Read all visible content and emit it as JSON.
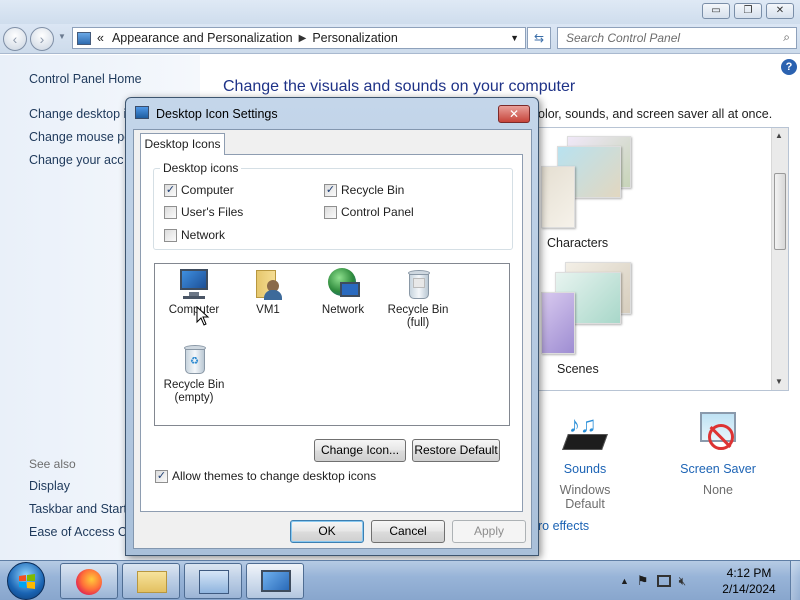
{
  "window": {
    "minimize": "▭",
    "maximize": "❐",
    "close": "✕"
  },
  "address_bar": {
    "prefix": "«",
    "crumbs": [
      "Appearance and Personalization",
      "Personalization"
    ],
    "search_placeholder": "Search Control Panel"
  },
  "left_pane": {
    "links": [
      "Control Panel Home",
      "Change desktop ic",
      "Change mouse po",
      "Change your acc"
    ],
    "see_also_label": "See also",
    "see_also": [
      "Display",
      "Taskbar and Start I",
      "Ease of Access Cer"
    ]
  },
  "main": {
    "heading": "Change the visuals and sounds on your computer",
    "subtitle": "olor, sounds, and screen saver all at once.",
    "themes": [
      {
        "label": "Characters"
      },
      {
        "label": "Scenes"
      }
    ],
    "bottom_items": [
      {
        "label": "Sounds",
        "sub": "Windows Default"
      },
      {
        "label": "Screen Saver",
        "sub": "None"
      }
    ],
    "color_link": "ro effects"
  },
  "dialog": {
    "title": "Desktop Icon Settings",
    "tab": "Desktop Icons",
    "group_label": "Desktop icons",
    "checkboxes": [
      {
        "label": "Computer",
        "checked": true
      },
      {
        "label": "Recycle Bin",
        "checked": true
      },
      {
        "label": "User's Files",
        "checked": false
      },
      {
        "label": "Control Panel",
        "checked": false
      },
      {
        "label": "Network",
        "checked": false
      }
    ],
    "preview_items": [
      {
        "label": "Computer",
        "icon": "computer-icon"
      },
      {
        "label": "VM1",
        "icon": "user-folder-icon"
      },
      {
        "label": "Network",
        "icon": "network-icon"
      },
      {
        "label": "Recycle Bin\n(full)",
        "icon": "recycle-bin-full-icon"
      },
      {
        "label": "Recycle Bin\n(empty)",
        "icon": "recycle-bin-empty-icon"
      }
    ],
    "change_icon": "Change Icon...",
    "restore_default": "Restore Default",
    "allow_themes": "Allow themes to change desktop icons",
    "allow_themes_checked": true,
    "ok": "OK",
    "cancel": "Cancel",
    "apply": "Apply"
  },
  "taskbar": {
    "apps": [
      "firefox-icon",
      "file-explorer-icon",
      "control-panel-icon",
      "desktop-icon-settings-icon"
    ],
    "time": "4:12 PM",
    "date": "2/14/2024"
  }
}
